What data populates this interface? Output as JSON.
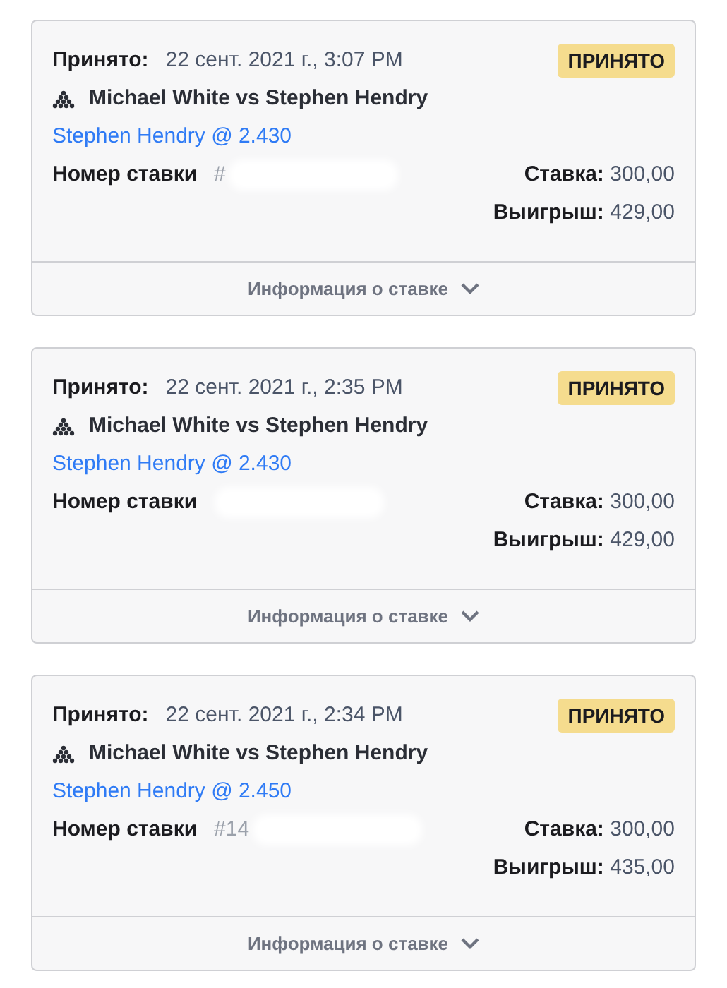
{
  "bets": [
    {
      "accepted_label": "Принято:",
      "accepted_at": "22 сент. 2021 г., 3:07 PM",
      "status": "ПРИНЯТО",
      "event": "Michael White vs Stephen Hendry",
      "selection": "Stephen Hendry @ 2.430",
      "bet_number_label": "Номер ставки",
      "bet_number": "#",
      "stake_label": "Ставка:",
      "stake": "300,00",
      "payout_label": "Выигрыш:",
      "payout": "429,00",
      "details": "Информация о ставке"
    },
    {
      "accepted_label": "Принято:",
      "accepted_at": "22 сент. 2021 г., 2:35 PM",
      "status": "ПРИНЯТО",
      "event": "Michael White vs Stephen Hendry",
      "selection": "Stephen Hendry @ 2.430",
      "bet_number_label": "Номер ставки",
      "stake_label": "Ставка:",
      "stake": "300,00",
      "payout_label": "Выигрыш:",
      "payout": "429,00",
      "details": "Информация о ставке"
    },
    {
      "accepted_label": "Принято:",
      "accepted_at": "22 сент. 2021 г., 2:34 PM",
      "status": "ПРИНЯТО",
      "event": "Michael White vs Stephen Hendry",
      "selection": "Stephen Hendry @ 2.450",
      "bet_number_label": "Номер ставки",
      "bet_number": "#14",
      "stake_label": "Ставка:",
      "stake": "300,00",
      "payout_label": "Выигрыш:",
      "payout": "435,00",
      "details": "Информация о ставке"
    }
  ]
}
